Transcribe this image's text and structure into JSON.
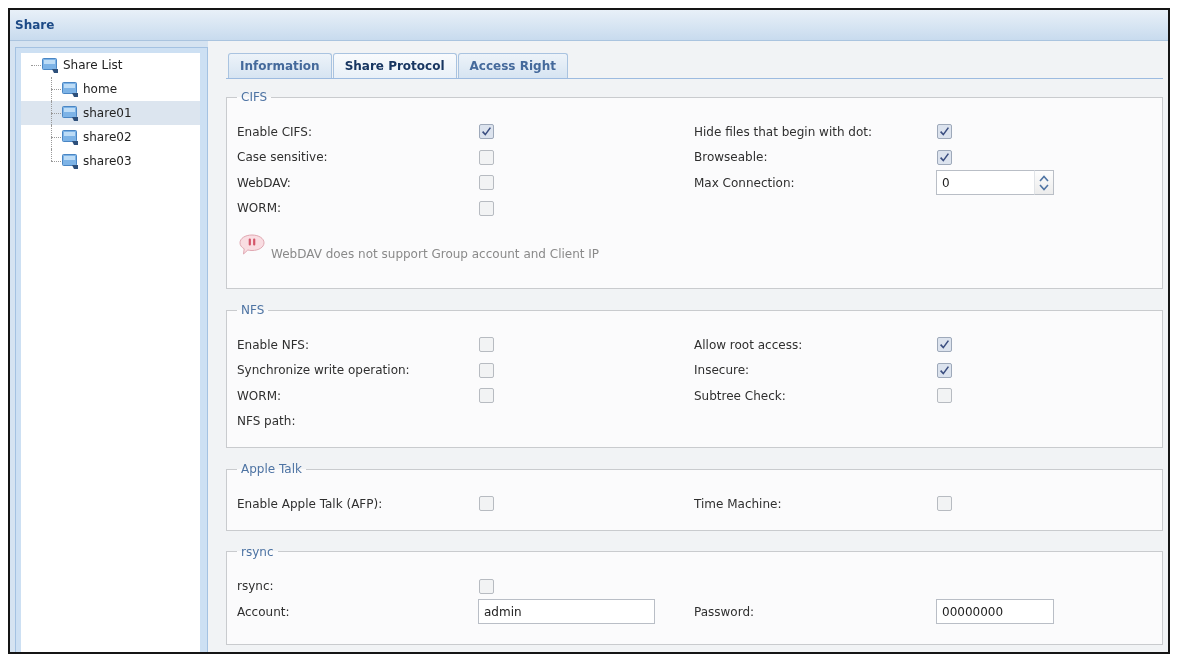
{
  "window": {
    "title": "Share"
  },
  "sidebar": {
    "tree": [
      {
        "label": "Share List",
        "selected": false,
        "children": [
          {
            "label": "home",
            "selected": false
          },
          {
            "label": "share01",
            "selected": true
          },
          {
            "label": "share02",
            "selected": false
          },
          {
            "label": "share03",
            "selected": false
          }
        ]
      }
    ]
  },
  "tabs": [
    {
      "label": "Information",
      "selected": false
    },
    {
      "label": "Share Protocol",
      "selected": true
    },
    {
      "label": "Access Right",
      "selected": false
    }
  ],
  "sections": [
    {
      "legend": "CIFS",
      "rows": [
        {
          "left": {
            "kind": "checkbox",
            "label": "Enable CIFS:",
            "checked": true
          },
          "right": {
            "kind": "checkbox",
            "label": "Hide files that begin with dot:",
            "checked": true
          }
        },
        {
          "left": {
            "kind": "checkbox",
            "label": "Case sensitive:",
            "checked": false
          },
          "right": {
            "kind": "checkbox",
            "label": "Browseable:",
            "checked": true
          }
        },
        {
          "left": {
            "kind": "checkbox",
            "label": "WebDAV:",
            "checked": false
          },
          "right": {
            "kind": "spinner",
            "label": "Max Connection:",
            "value": "0"
          }
        },
        {
          "left": {
            "kind": "checkbox",
            "label": "WORM:",
            "checked": false
          }
        }
      ],
      "note": "WebDAV does not support Group account and Client IP"
    },
    {
      "legend": "NFS",
      "rows": [
        {
          "left": {
            "kind": "checkbox",
            "label": "Enable NFS:",
            "checked": false
          },
          "right": {
            "kind": "checkbox",
            "label": "Allow root access:",
            "checked": true
          }
        },
        {
          "left": {
            "kind": "checkbox",
            "label": "Synchronize write operation:",
            "checked": false
          },
          "right": {
            "kind": "checkbox",
            "label": "Insecure:",
            "checked": true
          }
        },
        {
          "left": {
            "kind": "checkbox",
            "label": "WORM:",
            "checked": false
          },
          "right": {
            "kind": "checkbox",
            "label": "Subtree Check:",
            "checked": false
          }
        },
        {
          "left": {
            "kind": "label",
            "label": "NFS path:"
          }
        }
      ]
    },
    {
      "legend": "Apple Talk",
      "rows": [
        {
          "left": {
            "kind": "checkbox",
            "label": "Enable Apple Talk (AFP):",
            "checked": false
          },
          "right": {
            "kind": "checkbox",
            "label": "Time Machine:",
            "checked": false
          }
        }
      ]
    },
    {
      "legend": "rsync",
      "rows": [
        {
          "left": {
            "kind": "checkbox",
            "label": "rsync:",
            "checked": false
          }
        },
        {
          "left": {
            "kind": "text",
            "label": "Account:",
            "value": "admin"
          },
          "right": {
            "kind": "text",
            "label": "Password:",
            "value": "00000000"
          }
        }
      ]
    }
  ]
}
